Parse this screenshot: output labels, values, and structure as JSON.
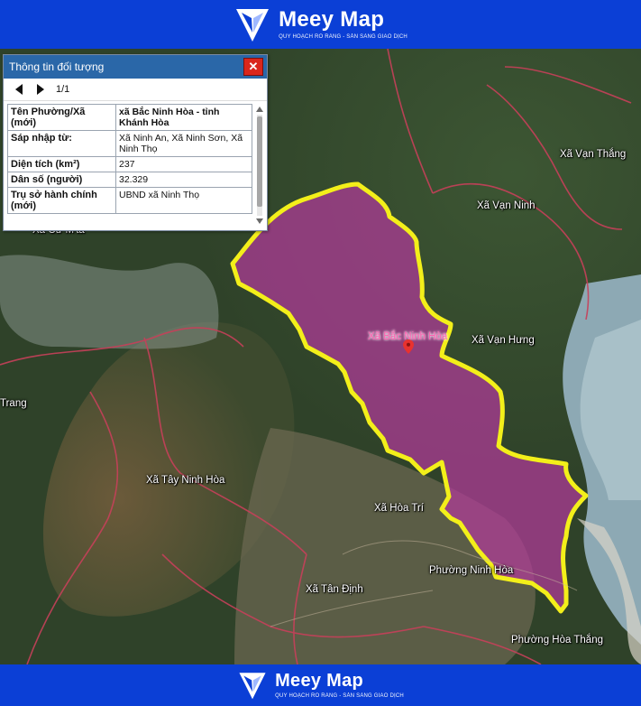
{
  "brand": {
    "name": "Meey Map",
    "tagline": "QUY HOẠCH RÕ RÀNG - SẴN SÀNG GIAO DỊCH",
    "bg_color": "#0b3fd6"
  },
  "panel": {
    "title": "Thông tin đối tượng",
    "close_label": "✕",
    "page_indicator": "1/1",
    "rows": [
      {
        "key": "Tên Phường/Xã (mới)",
        "value": "xã Bắc Ninh Hòa - tỉnh Khánh Hòa"
      },
      {
        "key": "Sáp nhập từ:",
        "value": "Xã Ninh An, Xã Ninh Sơn, Xã Ninh Thọ"
      },
      {
        "key": "Diện tích (km²)",
        "value": "237"
      },
      {
        "key": "Dân số (người)",
        "value": "32.329"
      },
      {
        "key": "Trụ sở hành chính (mới)",
        "value": "UBND xã Ninh Thọ"
      }
    ]
  },
  "map": {
    "highlight_color": "#b13a9a",
    "border_color": "#f3ef1a",
    "selected_label": "Xã Bắc Ninh Hòa",
    "labels": [
      "Xã Vạn Thắng",
      "Xã Vạn Ninh",
      "Xã Cư M'ta",
      "Xã Vạn Hưng",
      "Trang",
      "Xã Tây Ninh Hòa",
      "Xã Hòa Trí",
      "Phường Ninh Hòa",
      "Xã Tân Định",
      "Phường Hòa Thắng"
    ]
  }
}
